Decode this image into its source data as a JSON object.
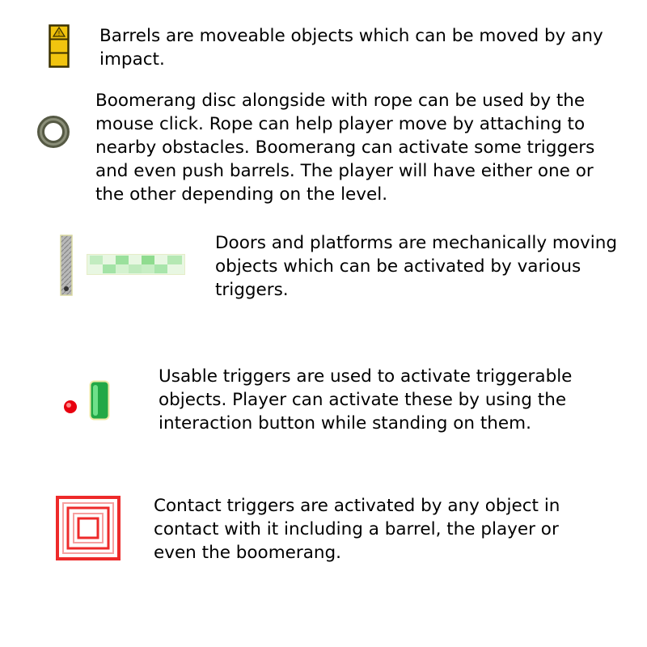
{
  "entries": [
    {
      "icon": "barrel-icon",
      "lines": [
        "Barrels are moveable objects which can be moved by any",
        "impact."
      ]
    },
    {
      "icon": "boomerang-disc-icon",
      "lines": [
        "Boomerang disc alongside with rope can be used by the",
        "mouse click. Rope can help player move by attaching to",
        "nearby obstacles. Boomerang can activate some triggers",
        "and even push barrels. The player will have either one or",
        "the other depending on the level."
      ]
    },
    {
      "icon": "door-and-platform-icons",
      "lines": [
        "Doors and platforms are mechanically moving",
        "objects which can be activated by various",
        "triggers."
      ]
    },
    {
      "icon": "usable-trigger-icons",
      "lines": [
        "Usable triggers are used to activate triggerable",
        "objects. Player can activate these by using the",
        "interaction button while standing on them."
      ]
    },
    {
      "icon": "contact-trigger-icon",
      "lines": [
        "Contact triggers are activated by any object in",
        "contact with it including a barrel, the player or",
        "even the boomerang."
      ]
    }
  ],
  "colors": {
    "barrel_fill": "#f1c40f",
    "barrel_outline": "#3a3000",
    "disc_ring": "#666a55",
    "door_gray": "#a9a9a9",
    "platform_green": "#8fdc8f",
    "trigger_red": "#e8000f",
    "trigger_green": "#22a846",
    "contact_red": "#ee2a2a"
  }
}
